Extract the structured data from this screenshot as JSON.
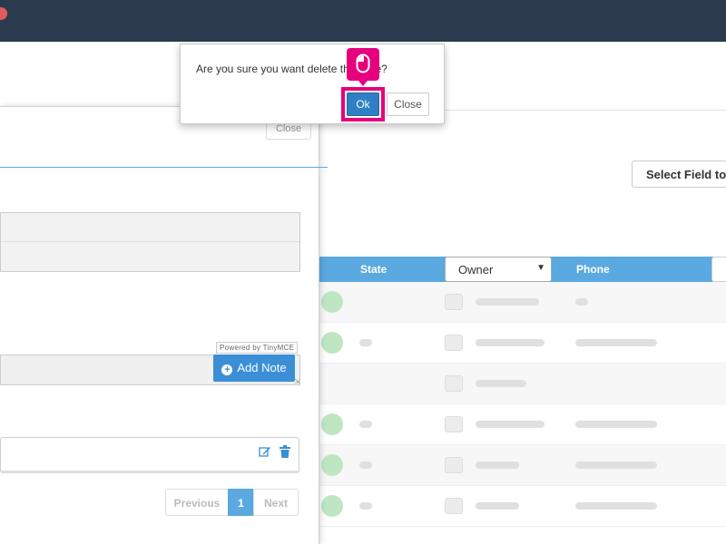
{
  "colors": {
    "navbar": "#2c3a4d",
    "accent": "#5aa9e0",
    "primary_button": "#2f7fc4",
    "highlight": "#e6007e"
  },
  "dialog": {
    "message": "Are you sure you want delete this note?",
    "ok_label": "Ok",
    "close_label": "Close"
  },
  "background": {
    "select_field_button": "Select Field to",
    "table": {
      "headers": {
        "state": "State",
        "phone": "Phone"
      },
      "owner_select": {
        "selected": "Owner"
      }
    }
  },
  "panel": {
    "close_label": "Close",
    "editor_branding": "Powered by TinyMCE",
    "add_note_label": "Add Note",
    "pagination": {
      "previous": "Previous",
      "current": "1",
      "next": "Next"
    }
  },
  "icons": {
    "cursor": "mouse-icon",
    "edit": "edit-icon",
    "delete": "trash-icon",
    "add": "plus-circle-icon"
  }
}
